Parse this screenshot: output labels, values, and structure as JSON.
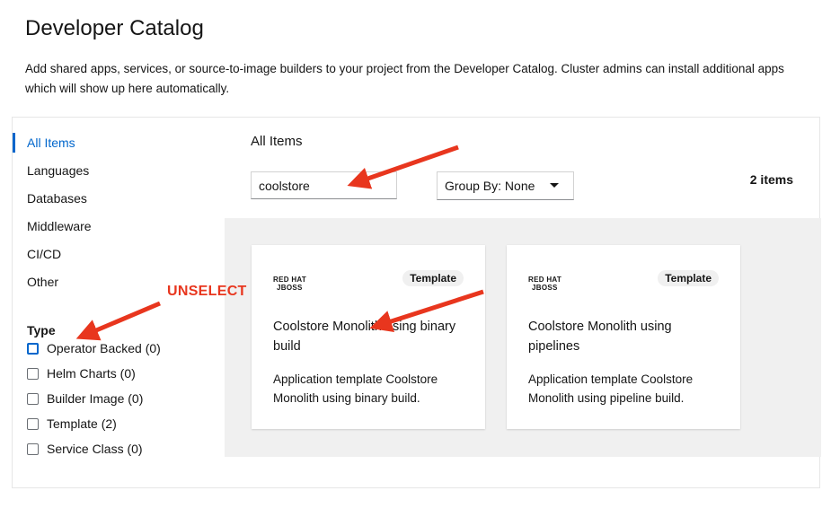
{
  "header": {
    "title": "Developer Catalog",
    "description": "Add shared apps, services, or source-to-image builders to your project from the Developer Catalog. Cluster admins can install additional apps which will show up here automatically."
  },
  "sidebar": {
    "categories": [
      {
        "label": "All Items",
        "active": true
      },
      {
        "label": "Languages"
      },
      {
        "label": "Databases"
      },
      {
        "label": "Middleware"
      },
      {
        "label": "CI/CD"
      },
      {
        "label": "Other"
      }
    ],
    "type_heading": "Type",
    "type_filters": [
      {
        "label": "Operator Backed (0)",
        "checked": false
      },
      {
        "label": "Helm Charts (0)",
        "checked": false
      },
      {
        "label": "Builder Image (0)",
        "checked": false
      },
      {
        "label": "Template (2)",
        "checked": false
      },
      {
        "label": "Service Class (0)",
        "checked": false
      }
    ]
  },
  "main": {
    "heading": "All Items",
    "search_value": "coolstore",
    "group_by_label": "Group By: None",
    "items_count": "2 items",
    "cards": [
      {
        "logo_line1": "RED HAT",
        "logo_line2": "JBOSS",
        "badge": "Template",
        "title": "Coolstore Monolith using binary build",
        "description": "Application template Coolstore Monolith using binary build."
      },
      {
        "logo_line1": "RED HAT",
        "logo_line2": "JBOSS",
        "badge": "Template",
        "title": "Coolstore Monolith using pipelines",
        "description": "Application template Coolstore Monolith using pipeline build."
      }
    ]
  },
  "annotations": {
    "unselect_label": "UNSELECT",
    "arrow_color": "#e8361e"
  },
  "colors": {
    "accent": "#0066cc",
    "card_area_bg": "#f0f0f0"
  }
}
